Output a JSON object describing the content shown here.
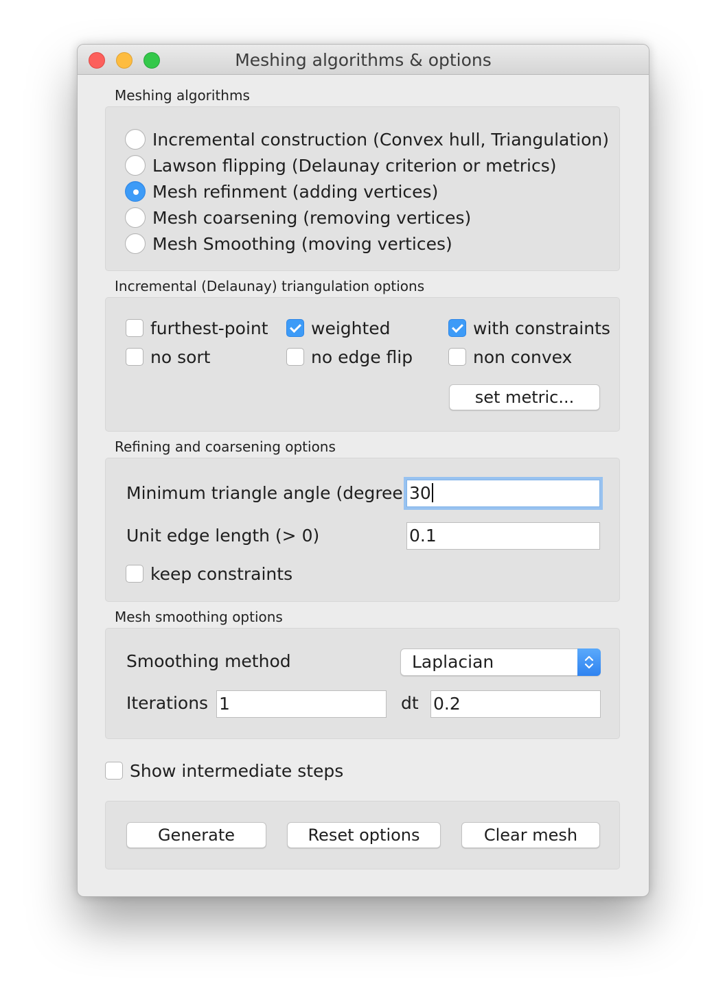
{
  "window": {
    "title": "Meshing algorithms & options"
  },
  "algorithms": {
    "label": "Meshing algorithms",
    "options": [
      {
        "label": "Incremental construction (Convex hull, Triangulation)",
        "selected": false
      },
      {
        "label": "Lawson flipping (Delaunay criterion or metrics)",
        "selected": false
      },
      {
        "label": "Mesh refinment (adding vertices)",
        "selected": true
      },
      {
        "label": "Mesh coarsening (removing vertices)",
        "selected": false
      },
      {
        "label": "Mesh Smoothing (moving vertices)",
        "selected": false
      }
    ]
  },
  "triangulation": {
    "label": "Incremental (Delaunay) triangulation options",
    "furthest_point": {
      "label": "furthest-point",
      "checked": false
    },
    "weighted": {
      "label": "weighted",
      "checked": true
    },
    "with_constraints": {
      "label": "with constraints",
      "checked": true
    },
    "no_sort": {
      "label": "no sort",
      "checked": false
    },
    "no_edge_flip": {
      "label": "no edge flip",
      "checked": false
    },
    "non_convex": {
      "label": "non convex",
      "checked": false
    },
    "set_metric": "set metric..."
  },
  "refining": {
    "label": "Refining and coarsening options",
    "min_angle_label": "Minimum triangle angle (degree)",
    "min_angle_value": "30",
    "edge_length_label": "Unit edge length (> 0)",
    "edge_length_value": "0.1",
    "keep_constraints": {
      "label": "keep constraints",
      "checked": false
    }
  },
  "smoothing": {
    "label": "Mesh smoothing options",
    "method_label": "Smoothing method",
    "method_value": "Laplacian",
    "iterations_label": "Iterations",
    "iterations_value": "1",
    "dt_label": "dt",
    "dt_value": "0.2"
  },
  "show_steps": {
    "label": "Show intermediate steps",
    "checked": false
  },
  "actions": {
    "generate": "Generate",
    "reset": "Reset options",
    "clear": "Clear mesh"
  },
  "colors": {
    "accent": "#3d9bf7",
    "close": "#fc605c",
    "minimize": "#fdbc40",
    "maximize": "#34c84a"
  }
}
